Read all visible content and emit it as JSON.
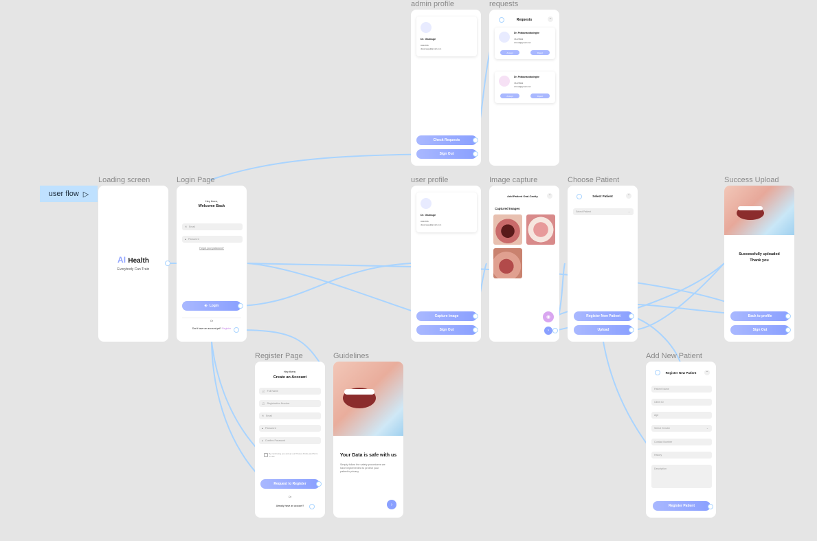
{
  "flow_badge": {
    "label": "user flow"
  },
  "frames": {
    "loading": {
      "title": "Loading screen",
      "brand_ai": "AI",
      "brand_health": "Health",
      "tagline": "Everybody Can Train"
    },
    "login": {
      "title": "Login Page",
      "greeting": "Hey there,",
      "heading": "Welcome Back",
      "email_placeholder": "Email",
      "password_placeholder": "Password",
      "forgot": "Forgot your password?",
      "login_button": "Login",
      "or": "Or",
      "no_account": "Don't have an account yet?",
      "register_link": "Register"
    },
    "admin_profile": {
      "title": "admin profile",
      "name": "Dr. Gamage",
      "line1": "0234786",
      "line2": "drgamage@gmail.com",
      "check_button": "Check Requests",
      "signout_button": "Sign Out"
    },
    "requests": {
      "title": "requests",
      "header": "Requests",
      "items": [
        {
          "name": "Dr. Prabanandasinghe",
          "line1": "76478564",
          "line2": "drmail@gmail.com",
          "accept": "Accept",
          "reject": "Reject"
        },
        {
          "name": "Dr. Prabanandasinghe",
          "line1": "76478564",
          "line2": "drmail@gmail.com",
          "accept": "Accept",
          "reject": "Reject"
        }
      ]
    },
    "user_profile": {
      "title": "user profile",
      "name": "Dr. Gamage",
      "line1": "0234786",
      "line2": "drgamage@gmail.com",
      "capture_button": "Capture Image",
      "signout_button": "Sign Out"
    },
    "image_capture": {
      "title": "Image capture",
      "header": "Add Patient Oral-Cavity",
      "section": "Captured Images"
    },
    "choose_patient": {
      "title": "Choose Patient",
      "header": "Select Patient",
      "select_placeholder": "Select Patient",
      "register_button": "Register New Patient",
      "upload_button": "Upload"
    },
    "success": {
      "title": "Success Upload",
      "line1": "Successfully uploaded",
      "line2": "Thank you",
      "back_button": "Back to profile",
      "signout_button": "Sign Out"
    },
    "register": {
      "title": "Register Page",
      "greeting": "Hey there,",
      "heading": "Create an Account",
      "fields": [
        "Full Name",
        "Registration Number",
        "Email",
        "Password",
        "Confirm Password"
      ],
      "terms": "By continuing you accept our Privacy Policy and Term of Use",
      "submit": "Request to Register",
      "or": "Or",
      "have_account": "Already have an account?"
    },
    "guidelines": {
      "title": "Guidelines",
      "heading": "Your Data is safe with us",
      "body": "Simply follow the safety procedures we have implemented to protect your patient's privacy"
    },
    "add_patient": {
      "title": "Add New Patient",
      "header": "Register New Patient",
      "fields": [
        "Patient Name",
        "Client ID",
        "Age",
        "Select Gender",
        "Contact Number",
        "History",
        "Description"
      ],
      "submit": "Register Patient"
    }
  },
  "colors": {
    "canvas": "#e5e5e5",
    "accent": "#8aa0ff",
    "connector": "#a9d4ff",
    "badge": "#bfe1ff"
  }
}
